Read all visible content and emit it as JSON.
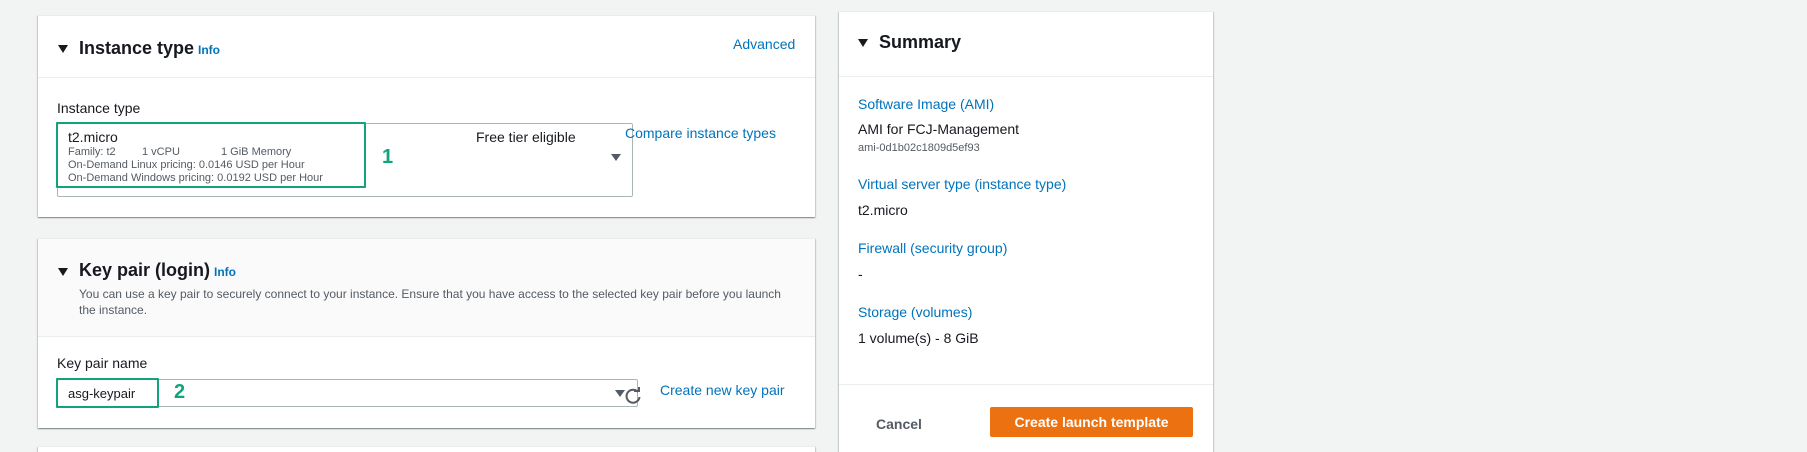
{
  "instance_type_panel": {
    "title": "Instance type",
    "info": "Info",
    "advanced": "Advanced",
    "field_label": "Instance type",
    "selected": {
      "name": "t2.micro",
      "family": "Family: t2",
      "vcpu": "1 vCPU",
      "memory": "1 GiB Memory",
      "linux_pricing": "On-Demand Linux pricing: 0.0146 USD per Hour",
      "windows_pricing": "On-Demand Windows pricing: 0.0192 USD per Hour",
      "badge": "Free tier eligible"
    },
    "compare_link": "Compare instance types",
    "callout": "1"
  },
  "key_pair_panel": {
    "title": "Key pair (login)",
    "info": "Info",
    "description": "You can use a key pair to securely connect to your instance. Ensure that you have access to the selected key pair before you launch the instance.",
    "field_label": "Key pair name",
    "selected": "asg-keypair",
    "create_link": "Create new key pair",
    "callout": "2"
  },
  "summary": {
    "title": "Summary",
    "items": [
      {
        "label": "Software Image (AMI)",
        "value": "AMI for FCJ-Management",
        "sub": "ami-0d1b02c1809d5ef93"
      },
      {
        "label": "Virtual server type (instance type)",
        "value": "t2.micro"
      },
      {
        "label": "Firewall (security group)",
        "value": "-"
      },
      {
        "label": "Storage (volumes)",
        "value": "1 volume(s) - 8 GiB"
      }
    ],
    "cancel": "Cancel",
    "create": "Create launch template"
  },
  "icons": {
    "expand": "caret-down-icon",
    "dropdown": "dropdown-caret-icon",
    "refresh": "refresh-icon"
  },
  "colors": {
    "link": "#0073bb",
    "highlight": "#12a37a",
    "primary": "#ec7211"
  }
}
